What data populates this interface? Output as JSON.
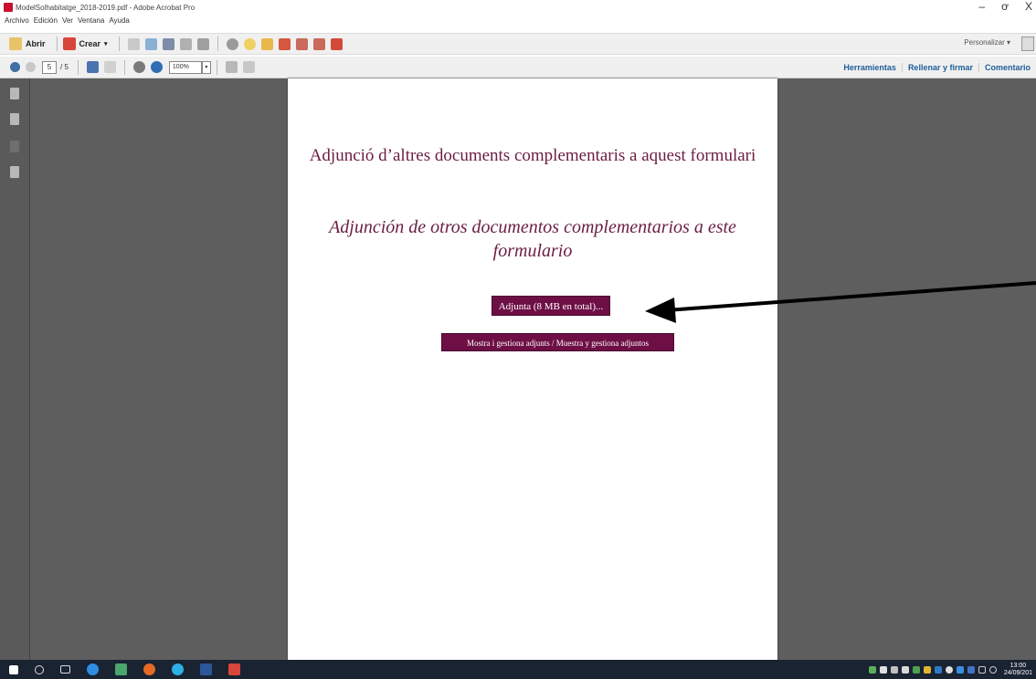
{
  "window": {
    "title": "ModelSolhabitatge_2018-2019.pdf - Adobe Acrobat Pro",
    "minimize": "–",
    "maximize": "ơ",
    "close": "X"
  },
  "menu": [
    "Archivo",
    "Edición",
    "Ver",
    "Ventana",
    "Ayuda"
  ],
  "toolbar": {
    "open_label": "Abrir",
    "create_label": "Crear",
    "customize_label": "Personalizar"
  },
  "navigation": {
    "current_page": "5",
    "page_total": "/ 5",
    "zoom": "100%"
  },
  "panels": {
    "tools": "Herramientas",
    "fill_sign": "Rellenar y firmar",
    "comments": "Comentario"
  },
  "document": {
    "heading_ca": "Adjunció d’altres documents complementaris a aquest formulari",
    "heading_es": "Adjunción de otros documentos complementarios a este formulario",
    "attach_button": "Adjunta (8 MB en total)...",
    "manage_button": "Mostra i gestiona adjunts / Muestra y gestiona adjuntos"
  },
  "taskbar": {
    "time": "13:00",
    "date": "24/09/201"
  },
  "colors": {
    "button_bg": "#6d0f45",
    "heading_color": "#6a1e40",
    "workspace_bg": "#5e5e5e",
    "taskbar_bg": "#1a2332"
  }
}
